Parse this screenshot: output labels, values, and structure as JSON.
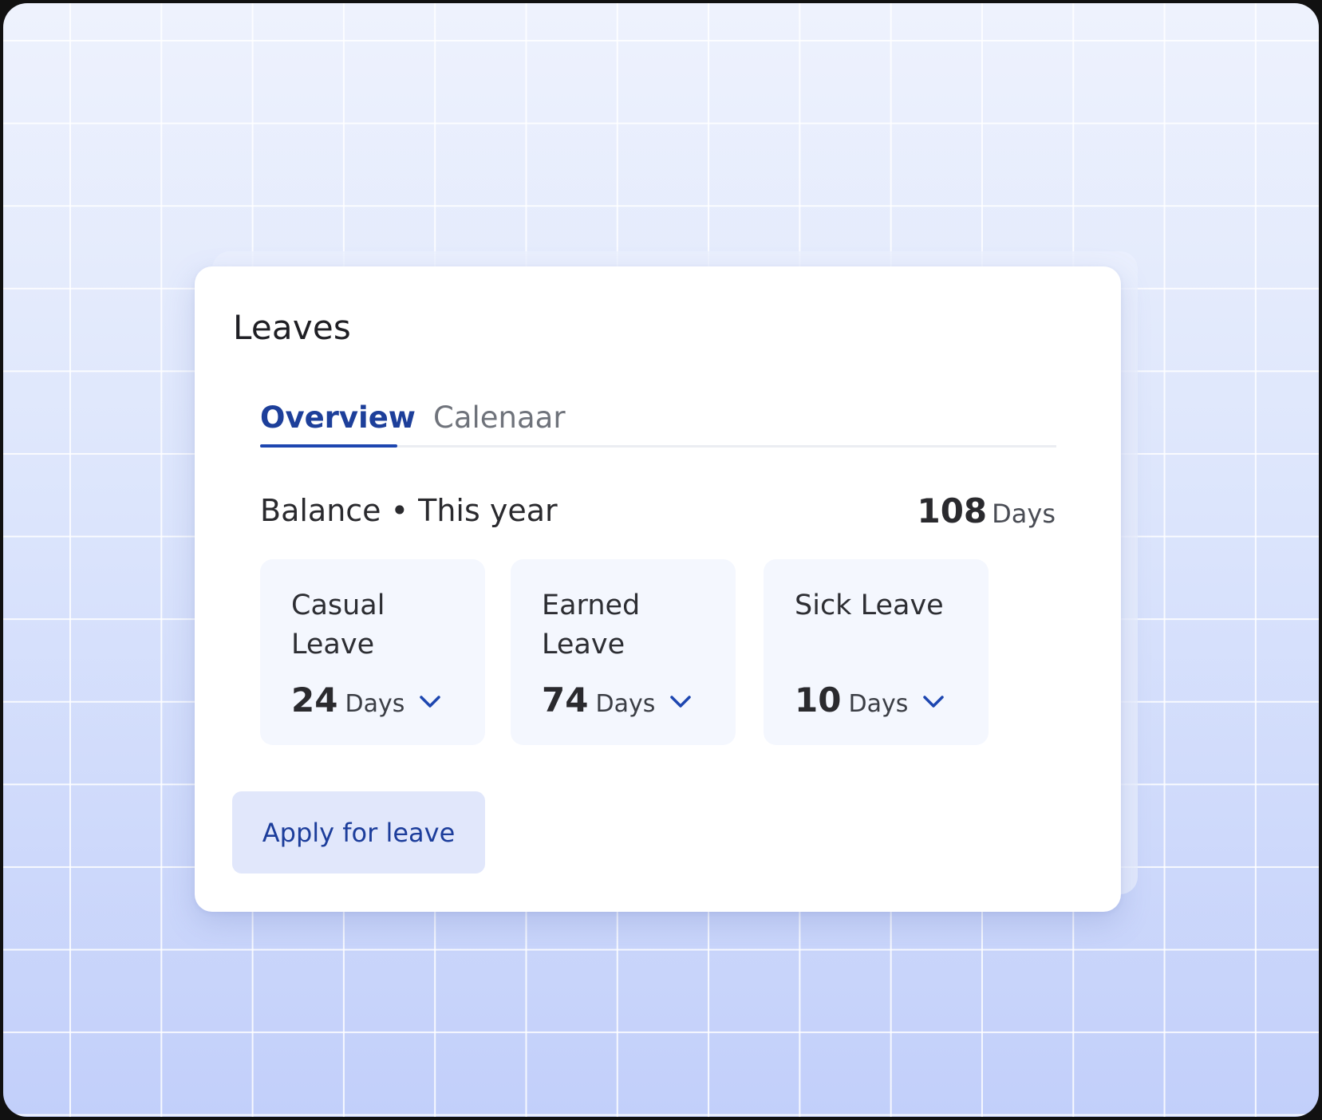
{
  "card": {
    "title": "Leaves"
  },
  "tabs": [
    {
      "label": "Overview",
      "active": true
    },
    {
      "label": "Calenaar",
      "active": false
    }
  ],
  "balance": {
    "label": "Balance • This year",
    "total_value": "108",
    "total_unit": "Days"
  },
  "leave_types": [
    {
      "name": "Casual Leave",
      "value": "24",
      "unit": "Days"
    },
    {
      "name": "Earned Leave",
      "value": "74",
      "unit": "Days"
    },
    {
      "name": "Sick Leave",
      "value": "10",
      "unit": "Days"
    }
  ],
  "actions": {
    "apply_label": "Apply for leave"
  },
  "colors": {
    "accent": "#1d46b0",
    "tab_active_text": "#1d3f9a",
    "button_bg": "#e1e7fb",
    "leave_card_bg": "#f4f7fe"
  },
  "icons": {
    "dropdown": "chevron-down-icon"
  }
}
